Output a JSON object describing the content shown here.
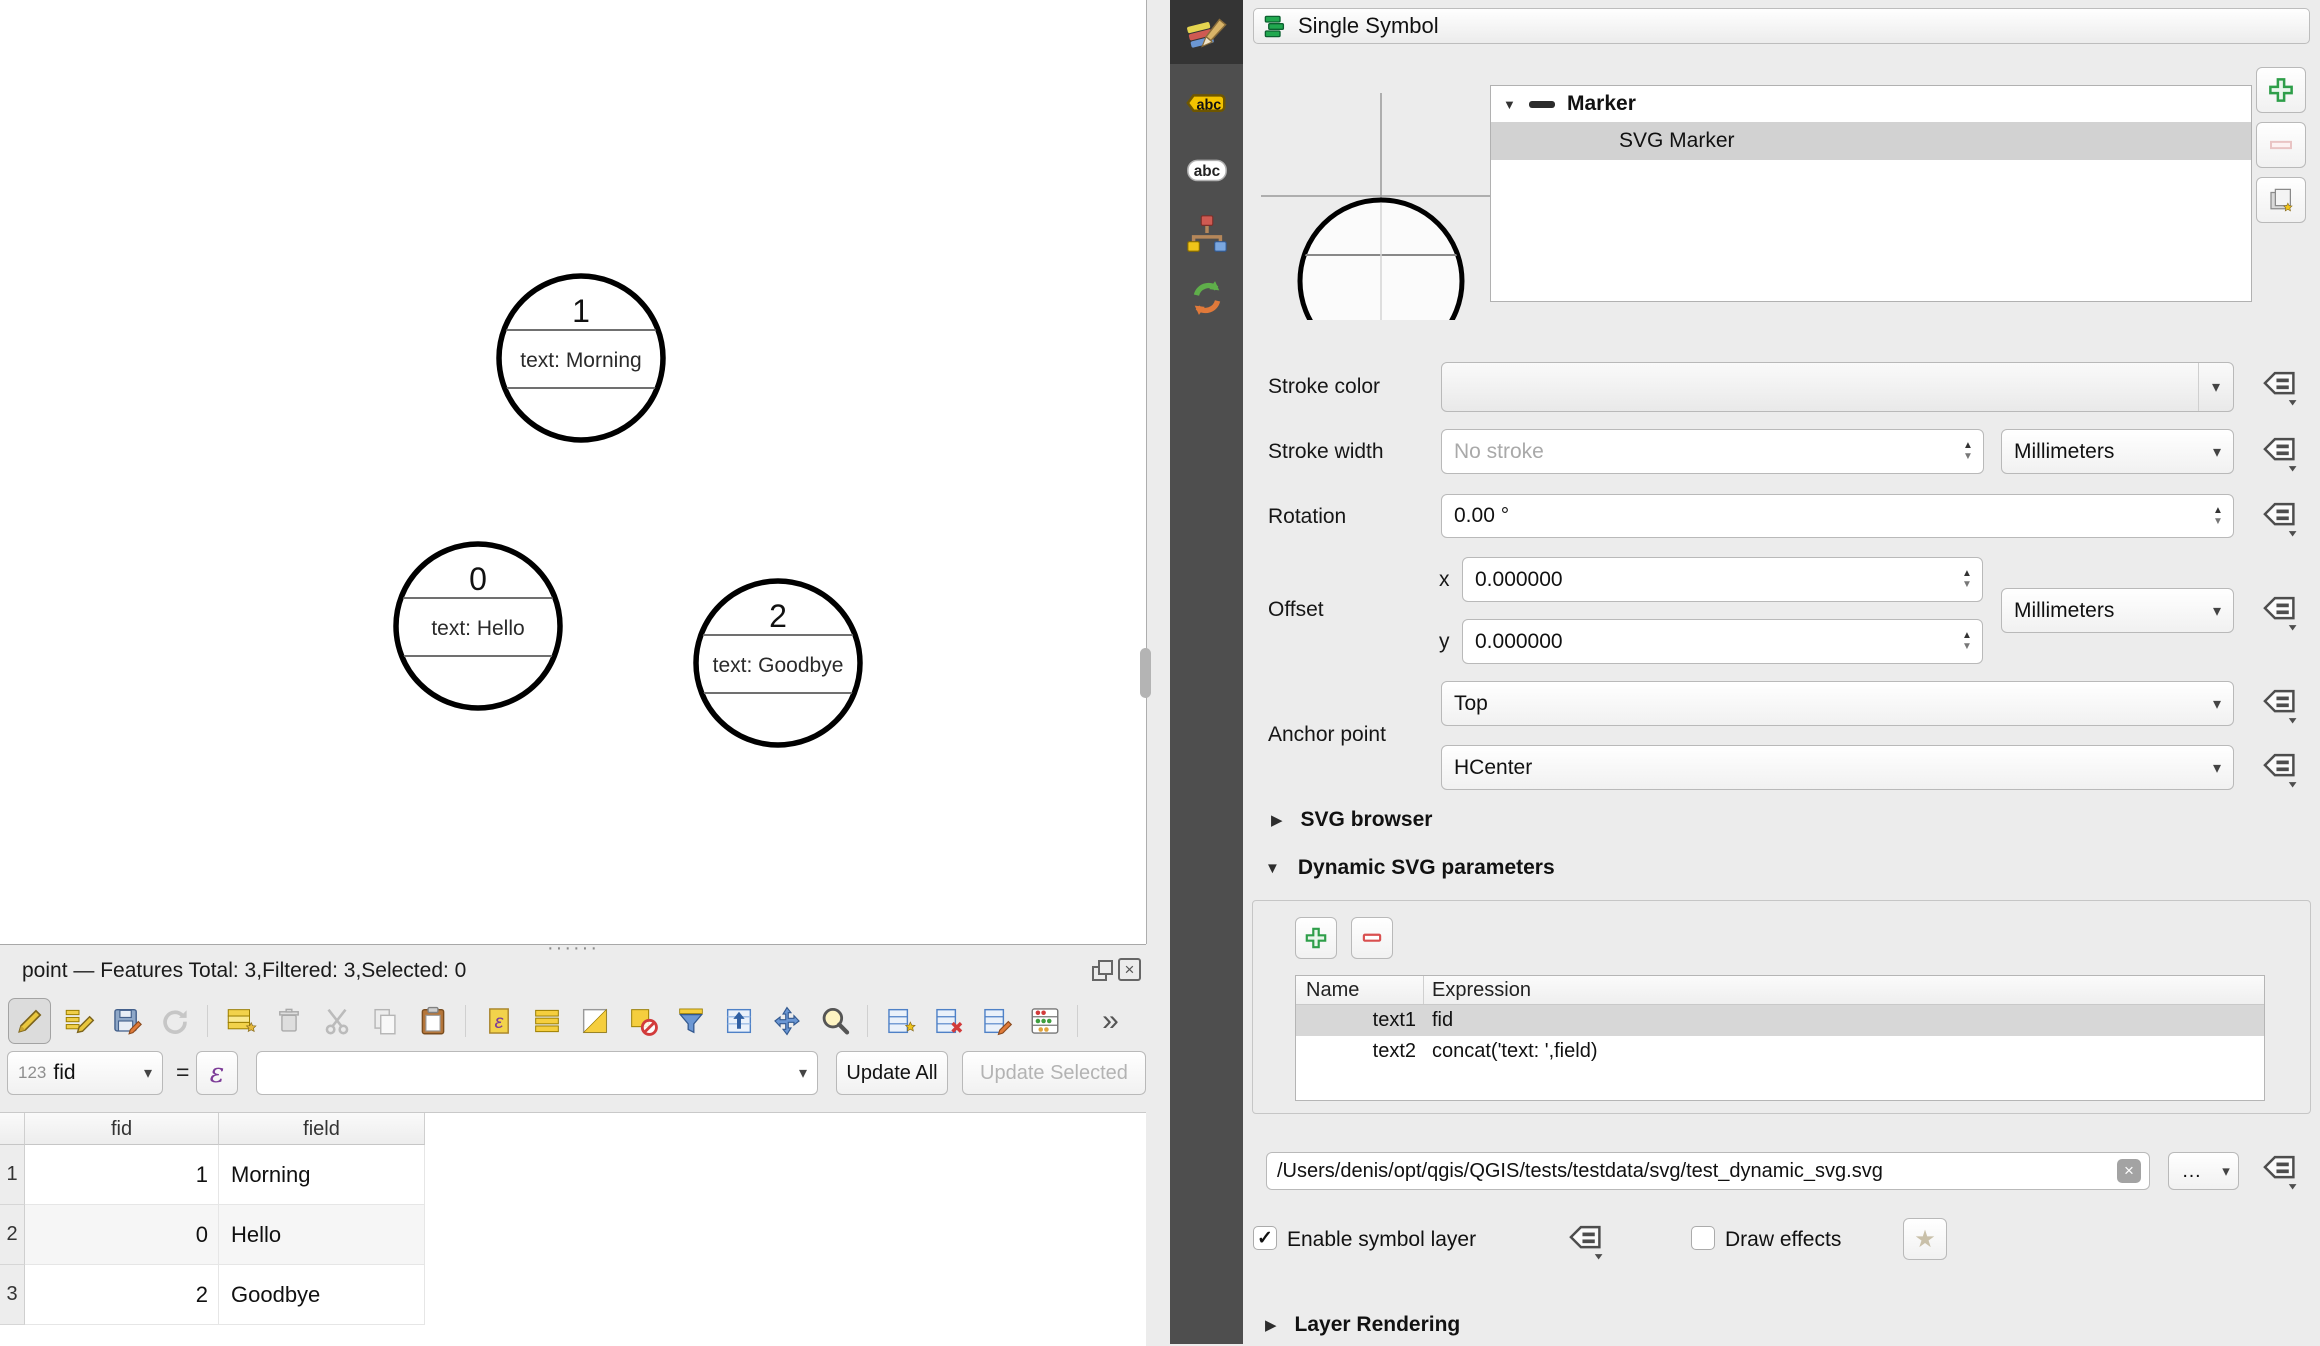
{
  "icons": {
    "caret_down": "▾",
    "spin_up": "▲",
    "spin_down": "▼",
    "tri_right": "▶",
    "tri_down": "▼",
    "check": "✓",
    "close": "×",
    "clear": "×",
    "handle_dots": "······",
    "star": "★",
    "epsilon": "ε",
    "more": "»",
    "abc_badge": "abc"
  },
  "sidebar": {
    "tabs": [
      "symbology",
      "labels",
      "masks",
      "diagrams",
      "history"
    ]
  },
  "map": {
    "markers": [
      {
        "fid": "1",
        "label": "text: Morning"
      },
      {
        "fid": "0",
        "label": "text: Hello"
      },
      {
        "fid": "2",
        "label": "text: Goodbye"
      }
    ]
  },
  "attribute_panel": {
    "title": "point — Features Total: 3,Filtered: 3,Selected: 0",
    "field_selector": {
      "type_badge": "123",
      "value": "fid"
    },
    "equals": "=",
    "expression_value": "",
    "update_all_label": "Update All",
    "update_selected_label": "Update Selected",
    "table": {
      "columns": [
        "fid",
        "field"
      ],
      "rows": [
        {
          "n": "1",
          "fid": "1",
          "field": "Morning"
        },
        {
          "n": "2",
          "fid": "0",
          "field": "Hello"
        },
        {
          "n": "3",
          "fid": "2",
          "field": "Goodbye"
        }
      ]
    }
  },
  "style_panel": {
    "renderer_label": "Single Symbol",
    "tree": {
      "parent": "Marker",
      "child": "SVG Marker"
    },
    "stroke_color_label": "Stroke color",
    "stroke_width_label": "Stroke width",
    "stroke_width_placeholder": "No stroke",
    "stroke_width_unit": "Millimeters",
    "rotation_label": "Rotation",
    "rotation_value": "0.00 °",
    "offset_label": "Offset",
    "offset_x_label": "x",
    "offset_x_value": "0.000000",
    "offset_y_label": "y",
    "offset_y_value": "0.000000",
    "offset_unit": "Millimeters",
    "anchor_label": "Anchor point",
    "anchor_vertical": "Top",
    "anchor_horizontal": "HCenter",
    "svg_browser_label": "SVG browser",
    "dynamic_params_label": "Dynamic SVG parameters",
    "layer_rendering_label": "Layer Rendering",
    "params_table": {
      "columns": [
        "Name",
        "Expression"
      ],
      "rows": [
        {
          "name": "text1",
          "expression": "fid"
        },
        {
          "name": "text2",
          "expression": "concat('text: ',field)"
        }
      ]
    },
    "svg_path": "/Users/denis/opt/qgis/QGIS/tests/testdata/svg/test_dynamic_svg.svg",
    "browse_label": "…",
    "enable_symbol_layer_label": "Enable symbol layer",
    "draw_effects_label": "Draw effects"
  }
}
